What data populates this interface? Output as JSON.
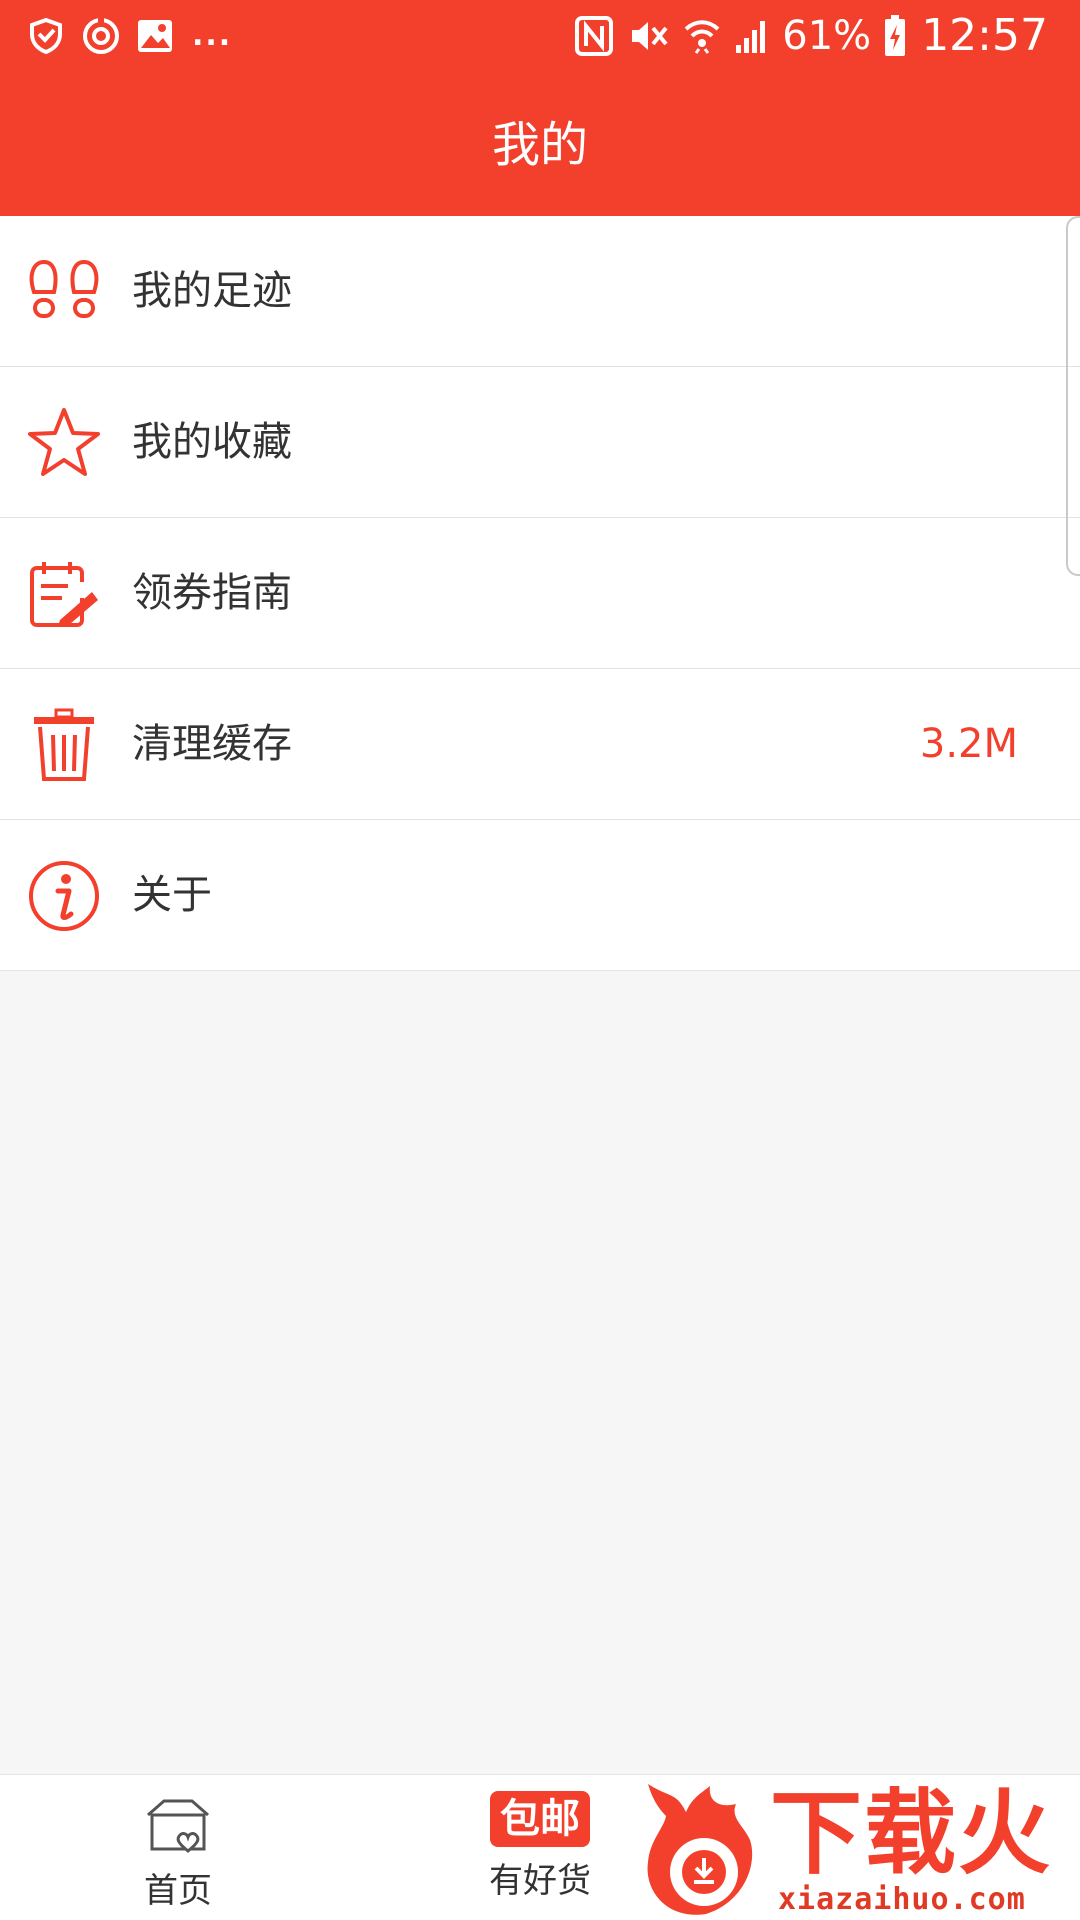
{
  "status_bar": {
    "icons_left": [
      "shield-check-icon",
      "sync-icon",
      "image-icon"
    ],
    "overflow": "...",
    "icons_right": [
      "nfc-icon",
      "vibrate-icon",
      "wifi-icon",
      "signal-icon",
      "battery-icon"
    ],
    "battery": "61%",
    "time": "12:57"
  },
  "header": {
    "title": "我的",
    "color": "#f2402d"
  },
  "menu": {
    "items": [
      {
        "label": "我的足迹",
        "icon": "footprints-icon"
      },
      {
        "label": "我的收藏",
        "icon": "star-icon"
      },
      {
        "label": "领券指南",
        "icon": "coupon-guide-icon"
      },
      {
        "label": "清理缓存",
        "icon": "trash-icon",
        "value": "3.2M"
      },
      {
        "label": "关于",
        "icon": "info-icon"
      }
    ]
  },
  "tabbar": {
    "home_label": "首页",
    "home_icon": "home-heart-icon",
    "deals_badge": "包邮",
    "deals_label": "有好货"
  },
  "watermark": {
    "title": "下载火",
    "domain": "xiazaihuo.com"
  }
}
